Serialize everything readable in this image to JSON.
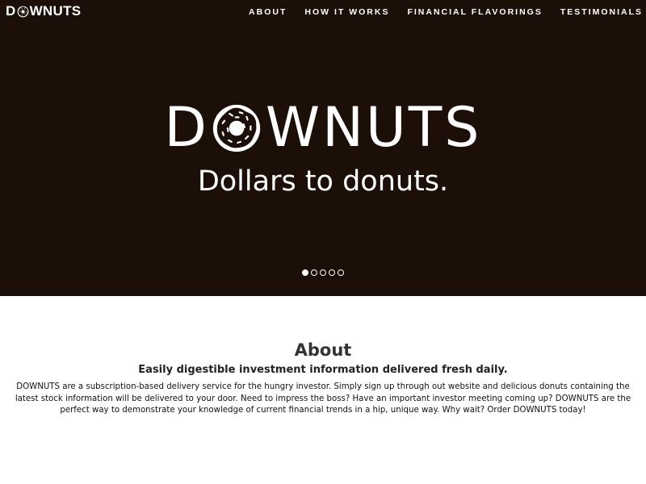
{
  "brand": {
    "name_before_o": "D",
    "name_after_o": "WNUTS",
    "logo_icon": "donut-icon"
  },
  "nav": {
    "items": [
      "ABOUT",
      "HOW IT WORKS",
      "FINANCIAL FLAVORINGS",
      "TESTIMONIALS"
    ]
  },
  "hero": {
    "title_before_o": "D",
    "title_after_o": "WNUTS",
    "tagline": "Dollars to donuts.",
    "slide_count": 5,
    "active_slide": 1,
    "background_color": "#1b0f08"
  },
  "about": {
    "title": "About",
    "subtitle": "Easily digestible investment information delivered fresh daily.",
    "body": "DOWNUTS are a subscription-based delivery service for the hungry investor. Simply sign up through out website and delicious donuts containing the latest stock information will be delivered to your door. Need to impress the boss? Have an important investor meeting coming up? DOWNUTS are the perfect way to demonstrate your knowledge of current financial trends in a hip, unique way. Why wait? Order DOWNUTS today!"
  }
}
